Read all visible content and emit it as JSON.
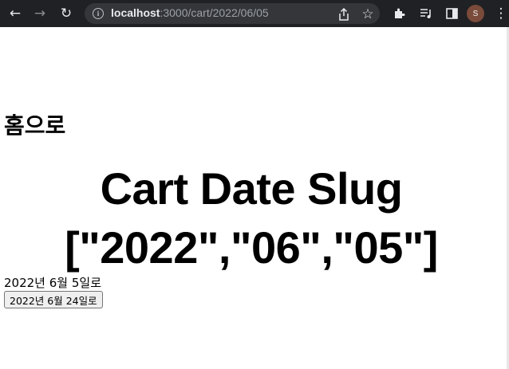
{
  "browser": {
    "url_host": "localhost",
    "url_path": ":3000/cart/2022/06/05",
    "avatar_initial": "S",
    "icons": [
      "back-icon",
      "forward-icon",
      "reload-icon",
      "info-icon",
      "share-icon",
      "star-icon",
      "extensions-icon",
      "playlist-icon",
      "side-panel-icon",
      "menu-icon"
    ]
  },
  "page": {
    "home_link": "홈으로",
    "title": "Cart Date Slug",
    "slug_display": "[\"2022\",\"06\",\"05\"]",
    "current_date_text": "2022년 6월 5일로",
    "change_button_label": "2022년 6월 24일로"
  }
}
